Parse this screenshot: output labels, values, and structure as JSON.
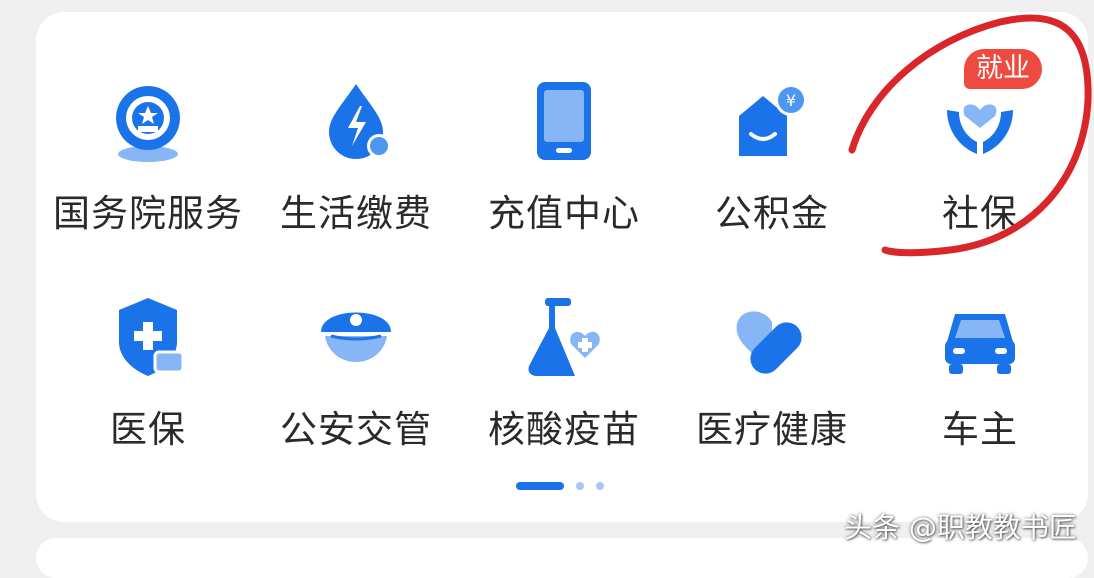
{
  "services": [
    {
      "label": "国务院服务",
      "icon": "state-council-emblem-icon"
    },
    {
      "label": "生活缴费",
      "icon": "utility-bill-drop-icon"
    },
    {
      "label": "充值中心",
      "icon": "tablet-topup-icon"
    },
    {
      "label": "公积金",
      "icon": "housing-fund-icon"
    },
    {
      "label": "社保",
      "icon": "social-security-hands-heart-icon"
    },
    {
      "label": "医保",
      "icon": "medical-insurance-shield-icon"
    },
    {
      "label": "公安交管",
      "icon": "police-cap-icon"
    },
    {
      "label": "核酸疫苗",
      "icon": "flask-heart-icon"
    },
    {
      "label": "医疗健康",
      "icon": "heart-bandage-icon"
    },
    {
      "label": "车主",
      "icon": "car-icon"
    }
  ],
  "badge": {
    "text": "就业"
  },
  "pagination": {
    "pages": 3,
    "active": 1
  },
  "watermark": {
    "text": "头条 @职教教书匠"
  },
  "colors": {
    "primary": "#1a73e8",
    "light": "#86b6f6",
    "badge": "#ef4a3f",
    "annotation": "#d9262b"
  }
}
